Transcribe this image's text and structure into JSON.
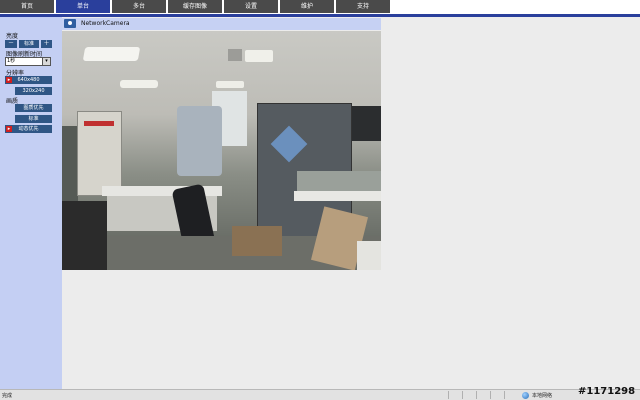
{
  "nav": {
    "tabs": [
      {
        "label": "首页"
      },
      {
        "label": "单台"
      },
      {
        "label": "多台"
      },
      {
        "label": "缓存图像"
      },
      {
        "label": "设置"
      },
      {
        "label": "维护"
      },
      {
        "label": "支持"
      }
    ],
    "active_index": 1,
    "active_color": "#2a3f9c"
  },
  "sidebar": {
    "brightness_label": "亮度",
    "brightness_minus": "－",
    "brightness_std": "标准",
    "brightness_plus": "＋",
    "refresh_label": "图像刷新时间",
    "refresh_value": "1秒",
    "resolution_label": "分辨率",
    "res_640": "640x480",
    "res_320": "320x240",
    "quality_label": "画质",
    "quality_image_first": "图质优先",
    "quality_standard": "标准",
    "quality_motion_first": "动态优先",
    "bg_color": "#c4cff3",
    "button_color": "#2f5685"
  },
  "camera": {
    "title": "NetworkCamera",
    "icon": "camera-icon"
  },
  "status": {
    "text": "完成",
    "zone": "本地网络"
  },
  "watermark": "#1171298"
}
